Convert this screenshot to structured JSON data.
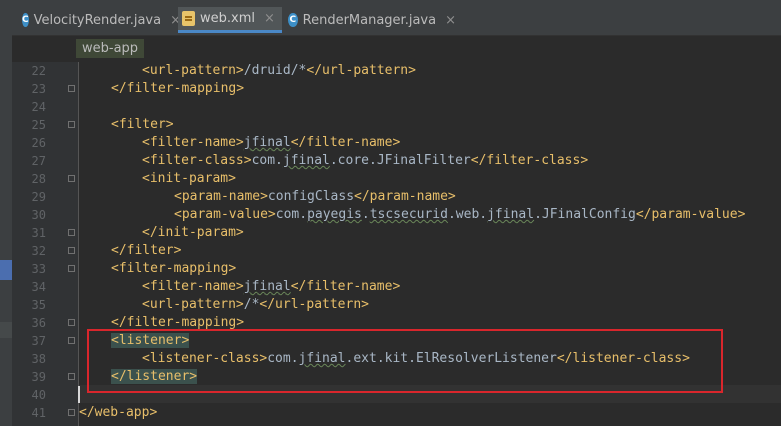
{
  "tabs": [
    {
      "label": "VelocityRender.java",
      "icon": "java-class-icon",
      "icon_char": "C",
      "active": false
    },
    {
      "label": "web.xml",
      "icon": "xml-file-icon",
      "active": true
    },
    {
      "label": "RenderManager.java",
      "icon": "java-class-icon",
      "icon_char": "C",
      "active": false
    }
  ],
  "close_glyph": "×",
  "breadcrumb": "web-app",
  "line_numbers": [
    "22",
    "23",
    "24",
    "25",
    "26",
    "27",
    "28",
    "29",
    "30",
    "31",
    "32",
    "33",
    "34",
    "35",
    "36",
    "37",
    "38",
    "39",
    "40",
    "41"
  ],
  "lines": {
    "l22": {
      "open": "<url-pattern>",
      "text": "/druid/*",
      "close": "</url-pattern>"
    },
    "l23": {
      "tag": "</filter-mapping>"
    },
    "l25": {
      "tag": "<filter>"
    },
    "l26": {
      "open": "<filter-name>",
      "text": "jfinal",
      "close": "</filter-name>"
    },
    "l27": {
      "open": "<filter-class>",
      "text_a": "com.",
      "text_b": "jfinal",
      "text_c": ".core.JFinalFilter",
      "close": "</filter-class>"
    },
    "l28": {
      "tag": "<init-param>"
    },
    "l29": {
      "open": "<param-name>",
      "text": "configClass",
      "close": "</param-name>"
    },
    "l30": {
      "open": "<param-value>",
      "text_a": "com.",
      "text_b": "payegis",
      "text_c": ".",
      "text_d": "tscsecurid",
      "text_e": ".web.",
      "text_f": "jfinal",
      "text_g": ".JFinalConfig",
      "close": "</param-value>"
    },
    "l31": {
      "tag": "</init-param>"
    },
    "l32": {
      "tag": "</filter>"
    },
    "l33": {
      "tag": "<filter-mapping>"
    },
    "l34": {
      "open": "<filter-name>",
      "text": "jfinal",
      "close": "</filter-name>"
    },
    "l35": {
      "open": "<url-pattern>",
      "text": "/*",
      "close": "</url-pattern>"
    },
    "l36": {
      "tag": "</filter-mapping>"
    },
    "l37": {
      "tag": "<listener>"
    },
    "l38": {
      "open": "<listener-class>",
      "text_a": "com.",
      "text_b": "jfinal",
      "text_c": ".ext.kit.ElResolverListener",
      "close": "</listener-class>"
    },
    "l39": {
      "tag": "</listener>"
    },
    "l41": {
      "tag": "</web-app>"
    }
  },
  "colors": {
    "tag": "#e8bf6a",
    "text": "#a9b7c6",
    "highlight_box": "#d9262c",
    "background": "#2b2b2b"
  }
}
